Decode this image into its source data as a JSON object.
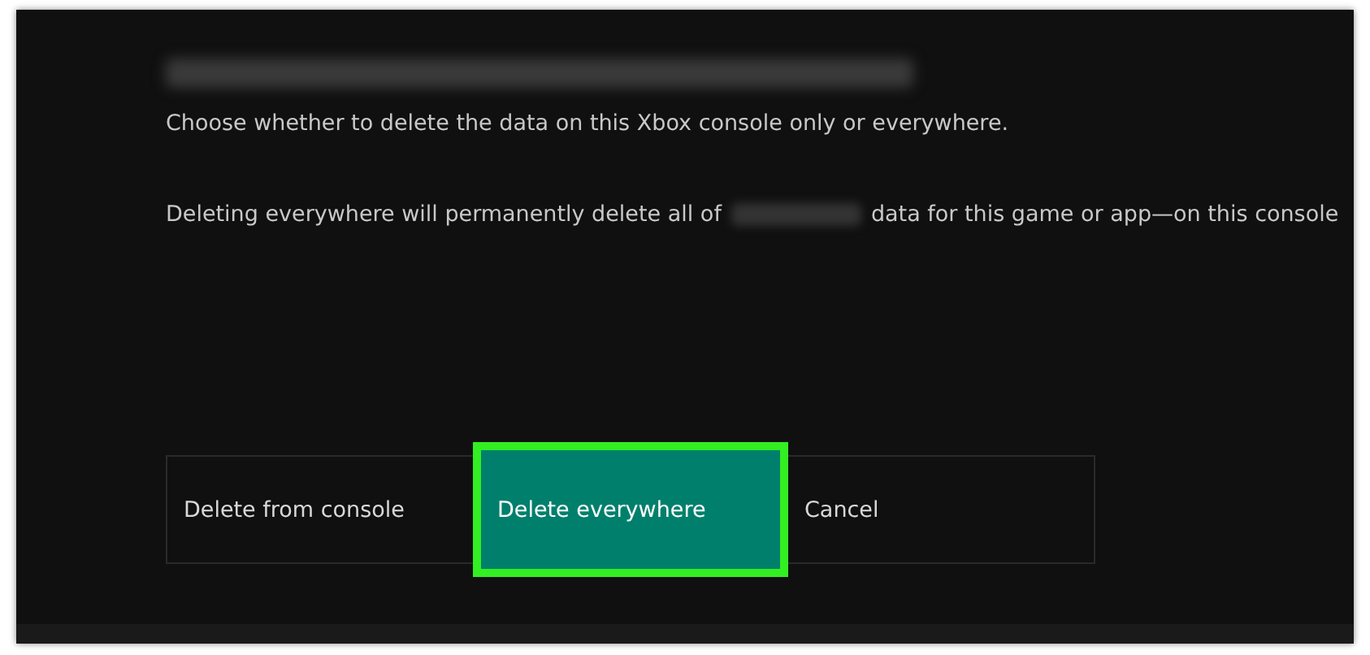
{
  "dialog": {
    "title_redacted": true,
    "message": "Choose whether to delete the data on this Xbox console only or everywhere.",
    "warning": {
      "before": "Deleting everywhere will permanently delete all of",
      "after": "data for this game or app—on this console"
    }
  },
  "buttons": [
    {
      "label": "Delete from console",
      "selected": false,
      "highlighted": false
    },
    {
      "label": "Delete everywhere",
      "selected": true,
      "highlighted": true
    },
    {
      "label": "Cancel",
      "selected": false,
      "highlighted": false
    }
  ]
}
